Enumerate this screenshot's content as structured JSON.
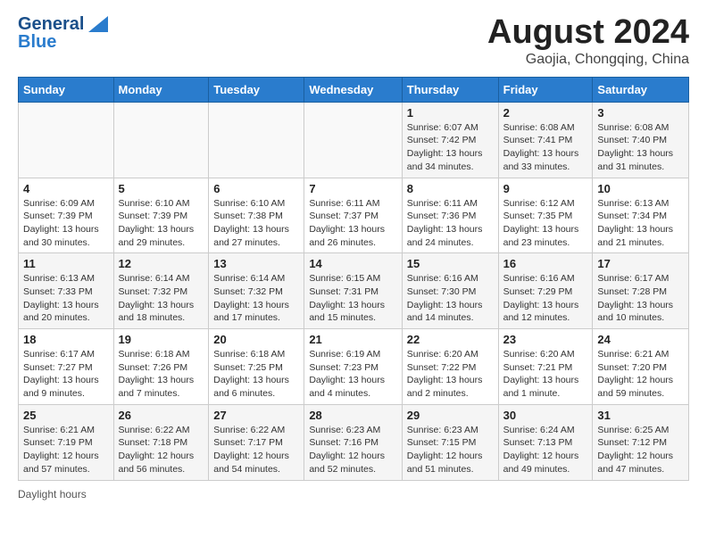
{
  "header": {
    "logo_general": "General",
    "logo_blue": "Blue",
    "title": "August 2024",
    "subtitle": "Gaojia, Chongqing, China"
  },
  "days_of_week": [
    "Sunday",
    "Monday",
    "Tuesday",
    "Wednesday",
    "Thursday",
    "Friday",
    "Saturday"
  ],
  "weeks": [
    [
      {
        "day": "",
        "info": ""
      },
      {
        "day": "",
        "info": ""
      },
      {
        "day": "",
        "info": ""
      },
      {
        "day": "",
        "info": ""
      },
      {
        "day": "1",
        "info": "Sunrise: 6:07 AM\nSunset: 7:42 PM\nDaylight: 13 hours and 34 minutes."
      },
      {
        "day": "2",
        "info": "Sunrise: 6:08 AM\nSunset: 7:41 PM\nDaylight: 13 hours and 33 minutes."
      },
      {
        "day": "3",
        "info": "Sunrise: 6:08 AM\nSunset: 7:40 PM\nDaylight: 13 hours and 31 minutes."
      }
    ],
    [
      {
        "day": "4",
        "info": "Sunrise: 6:09 AM\nSunset: 7:39 PM\nDaylight: 13 hours and 30 minutes."
      },
      {
        "day": "5",
        "info": "Sunrise: 6:10 AM\nSunset: 7:39 PM\nDaylight: 13 hours and 29 minutes."
      },
      {
        "day": "6",
        "info": "Sunrise: 6:10 AM\nSunset: 7:38 PM\nDaylight: 13 hours and 27 minutes."
      },
      {
        "day": "7",
        "info": "Sunrise: 6:11 AM\nSunset: 7:37 PM\nDaylight: 13 hours and 26 minutes."
      },
      {
        "day": "8",
        "info": "Sunrise: 6:11 AM\nSunset: 7:36 PM\nDaylight: 13 hours and 24 minutes."
      },
      {
        "day": "9",
        "info": "Sunrise: 6:12 AM\nSunset: 7:35 PM\nDaylight: 13 hours and 23 minutes."
      },
      {
        "day": "10",
        "info": "Sunrise: 6:13 AM\nSunset: 7:34 PM\nDaylight: 13 hours and 21 minutes."
      }
    ],
    [
      {
        "day": "11",
        "info": "Sunrise: 6:13 AM\nSunset: 7:33 PM\nDaylight: 13 hours and 20 minutes."
      },
      {
        "day": "12",
        "info": "Sunrise: 6:14 AM\nSunset: 7:32 PM\nDaylight: 13 hours and 18 minutes."
      },
      {
        "day": "13",
        "info": "Sunrise: 6:14 AM\nSunset: 7:32 PM\nDaylight: 13 hours and 17 minutes."
      },
      {
        "day": "14",
        "info": "Sunrise: 6:15 AM\nSunset: 7:31 PM\nDaylight: 13 hours and 15 minutes."
      },
      {
        "day": "15",
        "info": "Sunrise: 6:16 AM\nSunset: 7:30 PM\nDaylight: 13 hours and 14 minutes."
      },
      {
        "day": "16",
        "info": "Sunrise: 6:16 AM\nSunset: 7:29 PM\nDaylight: 13 hours and 12 minutes."
      },
      {
        "day": "17",
        "info": "Sunrise: 6:17 AM\nSunset: 7:28 PM\nDaylight: 13 hours and 10 minutes."
      }
    ],
    [
      {
        "day": "18",
        "info": "Sunrise: 6:17 AM\nSunset: 7:27 PM\nDaylight: 13 hours and 9 minutes."
      },
      {
        "day": "19",
        "info": "Sunrise: 6:18 AM\nSunset: 7:26 PM\nDaylight: 13 hours and 7 minutes."
      },
      {
        "day": "20",
        "info": "Sunrise: 6:18 AM\nSunset: 7:25 PM\nDaylight: 13 hours and 6 minutes."
      },
      {
        "day": "21",
        "info": "Sunrise: 6:19 AM\nSunset: 7:23 PM\nDaylight: 13 hours and 4 minutes."
      },
      {
        "day": "22",
        "info": "Sunrise: 6:20 AM\nSunset: 7:22 PM\nDaylight: 13 hours and 2 minutes."
      },
      {
        "day": "23",
        "info": "Sunrise: 6:20 AM\nSunset: 7:21 PM\nDaylight: 13 hours and 1 minute."
      },
      {
        "day": "24",
        "info": "Sunrise: 6:21 AM\nSunset: 7:20 PM\nDaylight: 12 hours and 59 minutes."
      }
    ],
    [
      {
        "day": "25",
        "info": "Sunrise: 6:21 AM\nSunset: 7:19 PM\nDaylight: 12 hours and 57 minutes."
      },
      {
        "day": "26",
        "info": "Sunrise: 6:22 AM\nSunset: 7:18 PM\nDaylight: 12 hours and 56 minutes."
      },
      {
        "day": "27",
        "info": "Sunrise: 6:22 AM\nSunset: 7:17 PM\nDaylight: 12 hours and 54 minutes."
      },
      {
        "day": "28",
        "info": "Sunrise: 6:23 AM\nSunset: 7:16 PM\nDaylight: 12 hours and 52 minutes."
      },
      {
        "day": "29",
        "info": "Sunrise: 6:23 AM\nSunset: 7:15 PM\nDaylight: 12 hours and 51 minutes."
      },
      {
        "day": "30",
        "info": "Sunrise: 6:24 AM\nSunset: 7:13 PM\nDaylight: 12 hours and 49 minutes."
      },
      {
        "day": "31",
        "info": "Sunrise: 6:25 AM\nSunset: 7:12 PM\nDaylight: 12 hours and 47 minutes."
      }
    ]
  ],
  "footer": {
    "label": "Daylight hours"
  }
}
